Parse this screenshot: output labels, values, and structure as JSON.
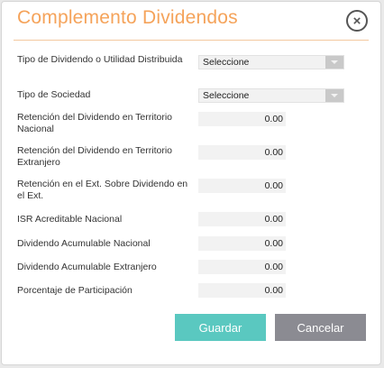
{
  "dialog": {
    "title": "Complemento Dividendos",
    "close_symbol": "×",
    "accent_color": "#f5a35a"
  },
  "fields": {
    "tipo_dividendo": {
      "label": "Tipo de Dividendo o Utilidad Distribuida",
      "value": "Seleccione"
    },
    "tipo_sociedad": {
      "label": "Tipo de Sociedad",
      "value": "Seleccione"
    },
    "ret_territorio_nacional": {
      "label": "Retención del Dividendo en Territorio Nacional",
      "value": "0.00"
    },
    "ret_territorio_extranjero": {
      "label": "Retención del Dividendo en Territorio Extranjero",
      "value": "0.00"
    },
    "ret_ext_sobre_dividendo": {
      "label": "Retención en el Ext. Sobre Dividendo en el Ext.",
      "value": "0.00"
    },
    "isr_acreditable_nacional": {
      "label": "ISR Acreditable Nacional",
      "value": "0.00"
    },
    "dividendo_acum_nacional": {
      "label": "Dividendo Acumulable Nacional",
      "value": "0.00"
    },
    "dividendo_acum_extranjero": {
      "label": "Dividendo Acumulable Extranjero",
      "value": "0.00"
    },
    "porcentaje_participacion": {
      "label": "Porcentaje de Participación",
      "value": "0.00"
    }
  },
  "buttons": {
    "save": {
      "label": "Guardar",
      "color": "#5ac8c0"
    },
    "cancel": {
      "label": "Cancelar",
      "color": "#8b8b92"
    }
  }
}
